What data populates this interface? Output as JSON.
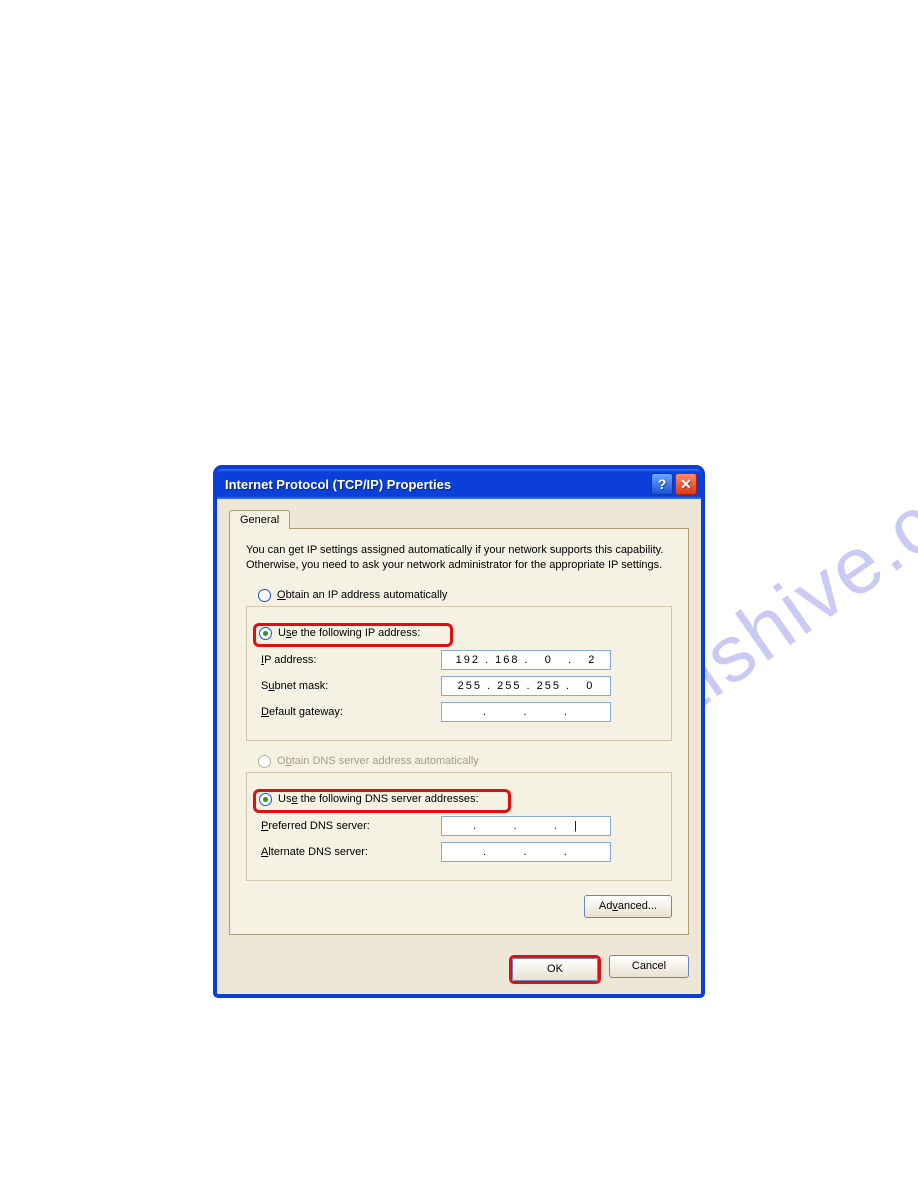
{
  "watermark": "manualshive.com",
  "window": {
    "title": "Internet Protocol (TCP/IP) Properties",
    "tab": "General",
    "description": "You can get IP settings assigned automatically if your network supports this capability. Otherwise, you need to ask your network administrator for the appropriate IP settings.",
    "ip_section": {
      "opt_auto": "Obtain an IP address automatically",
      "opt_manual": "Use the following IP address:",
      "fields": {
        "ip_label": "IP address:",
        "ip_value": "192 . 168 .   0   .   2",
        "subnet_label": "Subnet mask:",
        "subnet_value": "255 . 255 . 255 .   0",
        "gateway_label": "Default gateway:",
        "gateway_value": ".       .       ."
      }
    },
    "dns_section": {
      "opt_auto": "Obtain DNS server address automatically",
      "opt_manual": "Use the following DNS server addresses:",
      "fields": {
        "pref_label": "Preferred DNS server:",
        "pref_value": ".       .       .   |",
        "alt_label": "Alternate DNS server:",
        "alt_value": ".       .       ."
      }
    },
    "advanced_button": "Advanced...",
    "ok_button": "OK",
    "cancel_button": "Cancel"
  }
}
